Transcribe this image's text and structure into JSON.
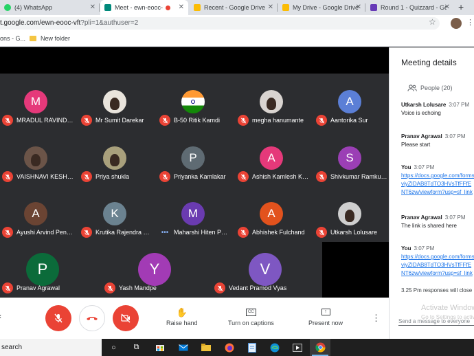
{
  "browser": {
    "tabs": [
      {
        "title": "(4) WhatsApp",
        "color": "#25d366"
      },
      {
        "title": "Meet - ewn-eooc-vft",
        "color": "#00897b",
        "active": true
      },
      {
        "title": "Recent - Google Drive",
        "color": "#fbbc04"
      },
      {
        "title": "My Drive - Google Drive",
        "color": "#fbbc04"
      },
      {
        "title": "Round 1 - Quizzard - Google Forms",
        "color": "#673ab7"
      }
    ],
    "address_host": "t.google.com/ewn-eooc-vft",
    "address_query": "?pli=1&authuser=2",
    "bookmarks": [
      "ons - G...",
      "New folder"
    ]
  },
  "meet": {
    "participants": [
      {
        "name": "MRADUL RAVINDRA",
        "initial": "M",
        "color": "#e5397a"
      },
      {
        "name": "Mr Sumit Darekar",
        "initial": "",
        "color": "#e9e4dc",
        "photo": true
      },
      {
        "name": "B-50 Ritik Kamdi",
        "initial": "",
        "color": "#ff9933",
        "photo": "flag"
      },
      {
        "name": "megha hanumante",
        "initial": "",
        "color": "#d9d4d0",
        "photo": true
      },
      {
        "name": "Aantorika Sur",
        "initial": "A",
        "color": "#5b7fd6"
      },
      {
        "name": "VAISHNAVI KESHAV",
        "initial": "",
        "color": "#6b5448",
        "photo": true
      },
      {
        "name": "Priya shukla",
        "initial": "",
        "color": "#a9a07c",
        "photo": true
      },
      {
        "name": "Priyanka Kamlakar",
        "initial": "P",
        "color": "#5f6b73"
      },
      {
        "name": "Ashish Kamlesh Kumar",
        "initial": "A",
        "color": "#e5397a"
      },
      {
        "name": "Shivkumar Ramkumar",
        "initial": "S",
        "color": "#9b3fb5"
      },
      {
        "name": "Ayushi Arvind Pendse",
        "initial": "A",
        "color": "#6b4433"
      },
      {
        "name": "Krutika Rajendra Patil",
        "initial": "K",
        "color": "#6b8290"
      },
      {
        "name": "Maharshi Hiten Patel",
        "initial": "M",
        "color": "#6a3bb0",
        "speaking": true
      },
      {
        "name": "Abhishek Fulchand",
        "initial": "A",
        "color": "#e2521d"
      },
      {
        "name": "Utkarsh Lolusare",
        "initial": "",
        "color": "#cfcfcf",
        "photo": true
      },
      {
        "name": "Pranav Agrawal",
        "initial": "P",
        "color": "#0b6b3a"
      },
      {
        "name": "Yash Mandpe",
        "initial": "Y",
        "color": "#a23bb5"
      },
      {
        "name": "Vedant Pramod Vyas",
        "initial": "V",
        "color": "#7e57c2"
      }
    ],
    "controls": {
      "raise_hand": "Raise hand",
      "captions": "Turn on captions",
      "present": "Present now",
      "cc_badge": "CC"
    }
  },
  "panel": {
    "title": "Meeting details",
    "people_label": "People (20)",
    "messages": [
      {
        "sender": "Utkarsh Lolusare",
        "time": "3:07 PM",
        "lines": [
          "Voice is echoing"
        ]
      },
      {
        "sender": "Pranav Agrawal",
        "time": "3:07 PM",
        "lines": [
          "Please start"
        ]
      },
      {
        "sender": "You",
        "time": "3:07 PM",
        "links": [
          "https://docs.google.com/forms/d/e/1FAIpQL",
          "viyZIDAB8TdTO3HVsTfFFfE",
          "NT6zw/viewform?usp=sf_link"
        ]
      },
      {
        "sender": "Pranav Agrawal",
        "time": "3:07 PM",
        "lines": [
          "The link is shared here"
        ]
      },
      {
        "sender": "You",
        "time": "3:07 PM",
        "links": [
          "https://docs.google.com/forms/d/e/1FAIpQL",
          "viyZIDAB8TdTO3HVsTfFFfE",
          "NT6zw/viewform?usp=sf_link"
        ]
      }
    ],
    "note": "3.25 Pm responses will close",
    "activate_title": "Activate Windows",
    "activate_sub": "Go to Settings to activate Windows.",
    "send_placeholder": "Send a message to everyone"
  },
  "taskbar": {
    "search_label": "search"
  }
}
